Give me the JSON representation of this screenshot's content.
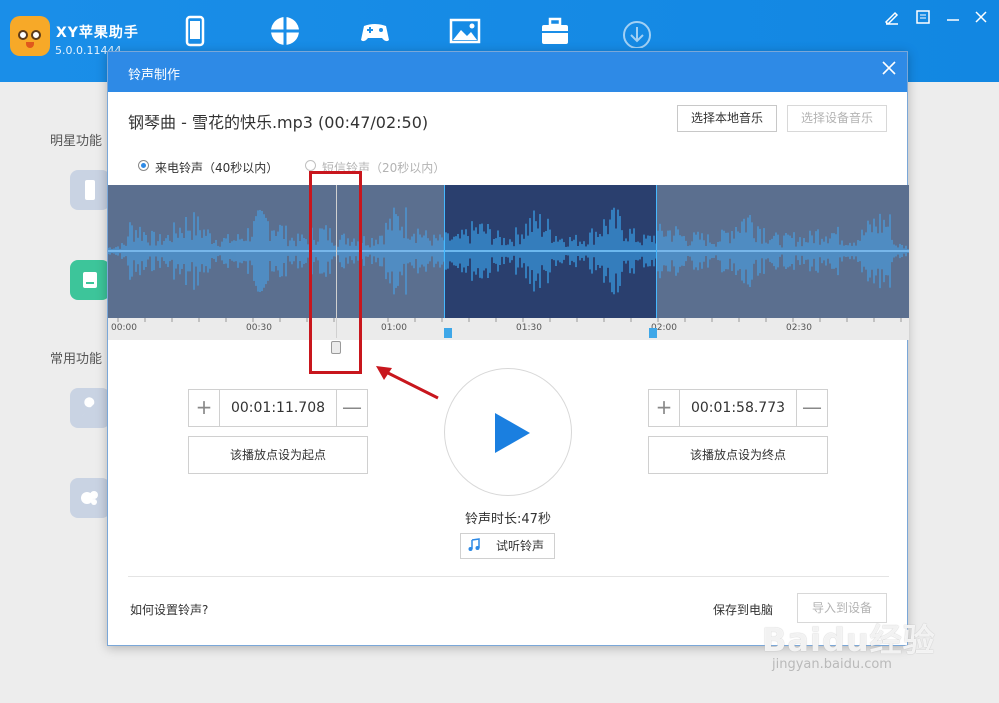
{
  "app": {
    "title": "XY苹果助手",
    "version": "5.0.0.11444"
  },
  "nav": {
    "icons": [
      "phone-icon",
      "apps-icon",
      "games-icon",
      "wallpaper-icon",
      "toolbox-icon",
      "download-icon"
    ]
  },
  "sidebar": {
    "section1_label": "明星功能",
    "section2_label": "常用功能"
  },
  "modal": {
    "title": "铃声制作",
    "file_title": "钢琴曲 - 雪花的快乐.mp3 (00:47/02:50)",
    "btn_local_music": "选择本地音乐",
    "btn_device_music": "选择设备音乐",
    "radio_call": "来电铃声（40秒以内）",
    "radio_sms": "短信铃声（20秒以内）",
    "timeline_ticks": [
      "00:00",
      "00:30",
      "01:00",
      "01:30",
      "02:00",
      "02:30"
    ],
    "start_time": "00:01:11.708",
    "end_time": "00:01:58.773",
    "set_start_label": "该播放点设为起点",
    "set_end_label": "该播放点设为终点",
    "plus": "+",
    "minus": "—",
    "duration_label": "铃声时长:47秒",
    "preview_label": "试听铃声",
    "help_link": "如何设置铃声?",
    "save_to_pc": "保存到电脑",
    "import_label": "导入到设备"
  },
  "watermark": {
    "main": "Baidu经验",
    "sub": "jingyan.baidu.com"
  },
  "colors": {
    "accent": "#2e8ae6",
    "selection": "#2a3f6e",
    "annotation": "#c8161d"
  }
}
